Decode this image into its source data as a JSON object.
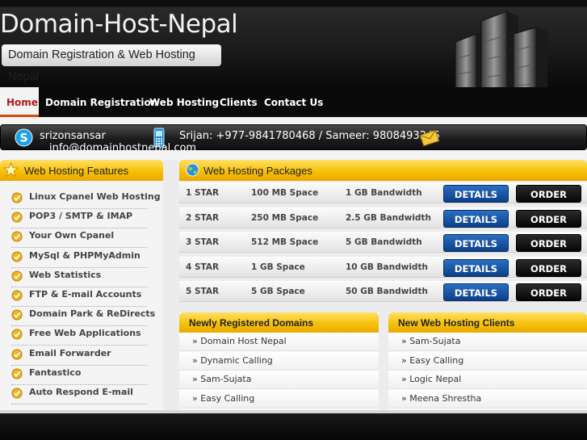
{
  "header": {
    "site_title": "Domain-Host-Nepal",
    "tagline": "Domain Registration & Web Hosting Nepal",
    "hero_icon": "server-rack-image"
  },
  "nav": {
    "items": [
      {
        "label": "Home",
        "active": true
      },
      {
        "label": "Domain Registration",
        "active": false
      },
      {
        "label": "Web Hosting",
        "active": false
      },
      {
        "label": "Clients",
        "active": false
      },
      {
        "label": "Contact Us",
        "active": false
      }
    ]
  },
  "contact": {
    "skype_id": "srizonsansar",
    "email": "info@domainhostnepal.com",
    "phones": "Srijan: +977-9841780468 / Sameer: 9808493246"
  },
  "features": {
    "title": "Web Hosting Features",
    "items": [
      "Linux Cpanel Web Hosting",
      "POP3 / SMTP & IMAP",
      "Your Own Cpanel",
      "MySql & PHPMyAdmin",
      "Web Statistics",
      "FTP & E-mail Accounts",
      "Domain Park & ReDirects",
      "Free Web Applications",
      "Email Forwarder",
      "Fantastico",
      "Auto Respond E-mail"
    ]
  },
  "packages": {
    "title": "Web Hosting Packages",
    "details_label": "DETAILS",
    "order_label": "ORDER",
    "rows": [
      {
        "name": "1 STAR",
        "space": "100 MB Space",
        "bandwidth": "1 GB Bandwidth"
      },
      {
        "name": "2 STAR",
        "space": "250 MB Space",
        "bandwidth": "2.5 GB Bandwidth"
      },
      {
        "name": "3 STAR",
        "space": "512 MB Space",
        "bandwidth": "5 GB Bandwidth"
      },
      {
        "name": "4 STAR",
        "space": "1 GB Space",
        "bandwidth": "10 GB Bandwidth"
      },
      {
        "name": "5 STAR",
        "space": "5 GB Space",
        "bandwidth": "50 GB Bandwidth"
      }
    ]
  },
  "domains": {
    "title": "Newly Registered Domains",
    "items": [
      "» Domain Host Nepal",
      "» Dynamic Calling",
      "» Sam-Sujata",
      "» Easy Calling"
    ]
  },
  "clients": {
    "title": "New Web Hosting Clients",
    "items": [
      "» Sam-Sujata",
      "» Easy Calling",
      "» Logic Nepal",
      "» Meena Shrestha"
    ]
  },
  "colors": {
    "accent_yellow": "#f7c007",
    "details_blue": "#0c3f86",
    "nav_active_red": "#b01818"
  }
}
